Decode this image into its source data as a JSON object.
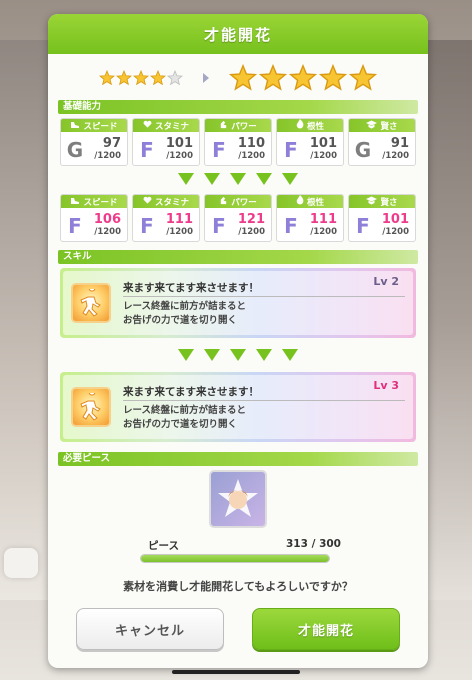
{
  "title": "才能開花",
  "rank": {
    "current_stars": 4,
    "current_max": 5,
    "next_stars": 5
  },
  "basic_section": "基礎能力",
  "stats_before": [
    {
      "label": "スピード",
      "icon": "shoe-icon",
      "rank": "G",
      "value": "97",
      "max": "/1200"
    },
    {
      "label": "スタミナ",
      "icon": "heart-icon",
      "rank": "F",
      "value": "101",
      "max": "/1200"
    },
    {
      "label": "パワー",
      "icon": "arm-icon",
      "rank": "F",
      "value": "110",
      "max": "/1200"
    },
    {
      "label": "根性",
      "icon": "flame-icon",
      "rank": "F",
      "value": "101",
      "max": "/1200"
    },
    {
      "label": "賢さ",
      "icon": "graduation-cap-icon",
      "rank": "G",
      "value": "91",
      "max": "/1200"
    }
  ],
  "stats_after": [
    {
      "label": "スピード",
      "icon": "shoe-icon",
      "rank": "F",
      "value": "106",
      "max": "/1200"
    },
    {
      "label": "スタミナ",
      "icon": "heart-icon",
      "rank": "F",
      "value": "111",
      "max": "/1200"
    },
    {
      "label": "パワー",
      "icon": "arm-icon",
      "rank": "F",
      "value": "121",
      "max": "/1200"
    },
    {
      "label": "根性",
      "icon": "flame-icon",
      "rank": "F",
      "value": "111",
      "max": "/1200"
    },
    {
      "label": "賢さ",
      "icon": "graduation-cap-icon",
      "rank": "F",
      "value": "101",
      "max": "/1200"
    }
  ],
  "skill_section": "スキル",
  "skill_before": {
    "name": "来ます来てます来させます！",
    "level": "Lv 2",
    "desc1": "レース終盤に前方が詰まると",
    "desc2": "お告げの力で道を切り開く"
  },
  "skill_after": {
    "name": "来ます来てます来させます！",
    "level": "Lv 3",
    "desc1": "レース終盤に前方が詰まると",
    "desc2": "お告げの力で道を切り開く"
  },
  "piece_section": "必要ピース",
  "piece": {
    "label": "ピース",
    "count": "313 / 300",
    "progress": 1.0
  },
  "confirm_text": "素材を消費し才能開花してもよろしいですか？",
  "buttons": {
    "cancel": "キャンセル",
    "ok": "才能開花"
  },
  "colors": {
    "header_green": "#7bc324",
    "star_gold": "#f7c531",
    "rank_f": "#8f7fd8",
    "rank_g": "#7e7e7e",
    "value_up_pink": "#ee3b8b"
  }
}
